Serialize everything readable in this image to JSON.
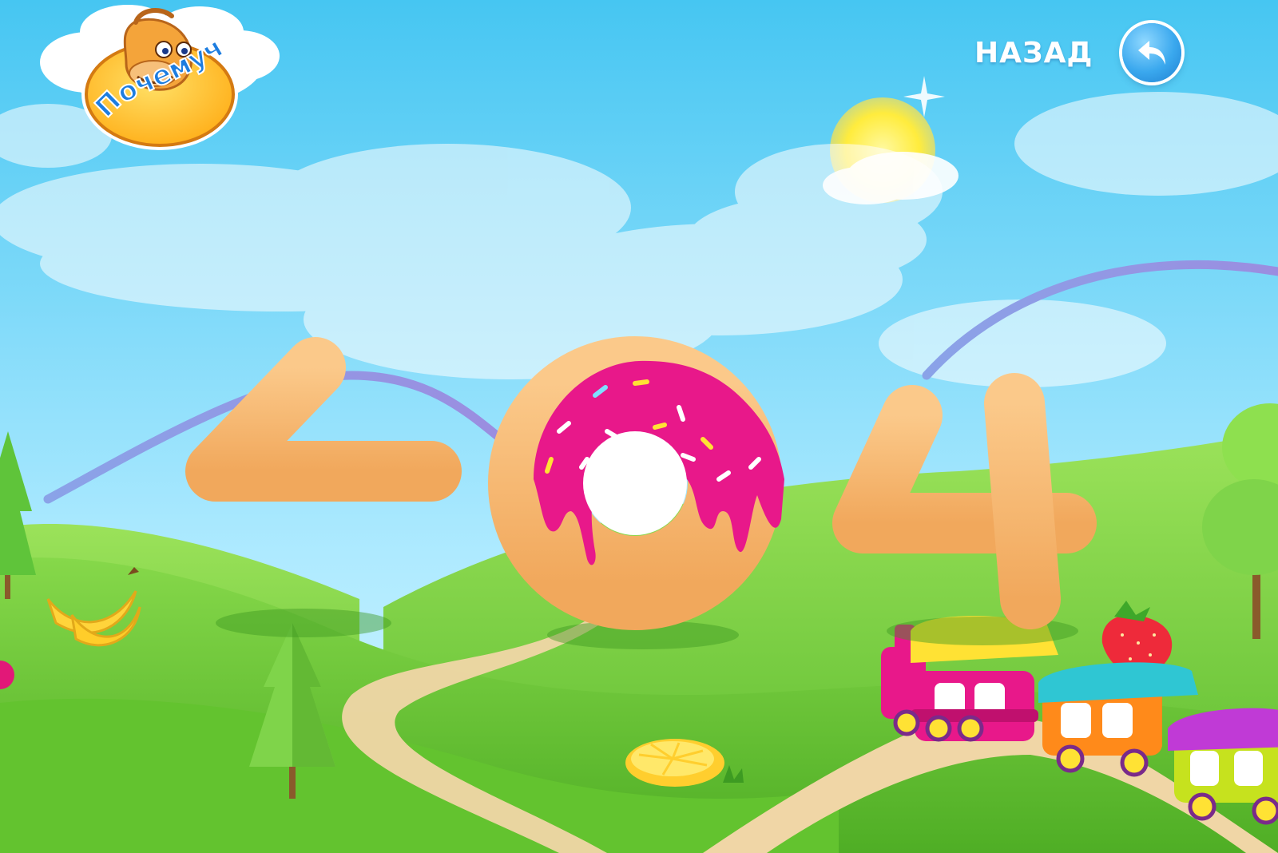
{
  "brand": {
    "name": "Почемучка"
  },
  "nav": {
    "back_label": "НАЗАД"
  },
  "error": {
    "code": "404"
  },
  "icons": {
    "back": "back-arrow-icon",
    "logo": "camel-mascot-logo",
    "donut": "donut-icon"
  },
  "colors": {
    "sky_top": "#46c6f2",
    "sky_bottom": "#c6f4ff",
    "grass": "#6fc93a",
    "digits": "#f5b46a",
    "donut_glaze": "#e8188a",
    "button": "#2e9be6"
  }
}
